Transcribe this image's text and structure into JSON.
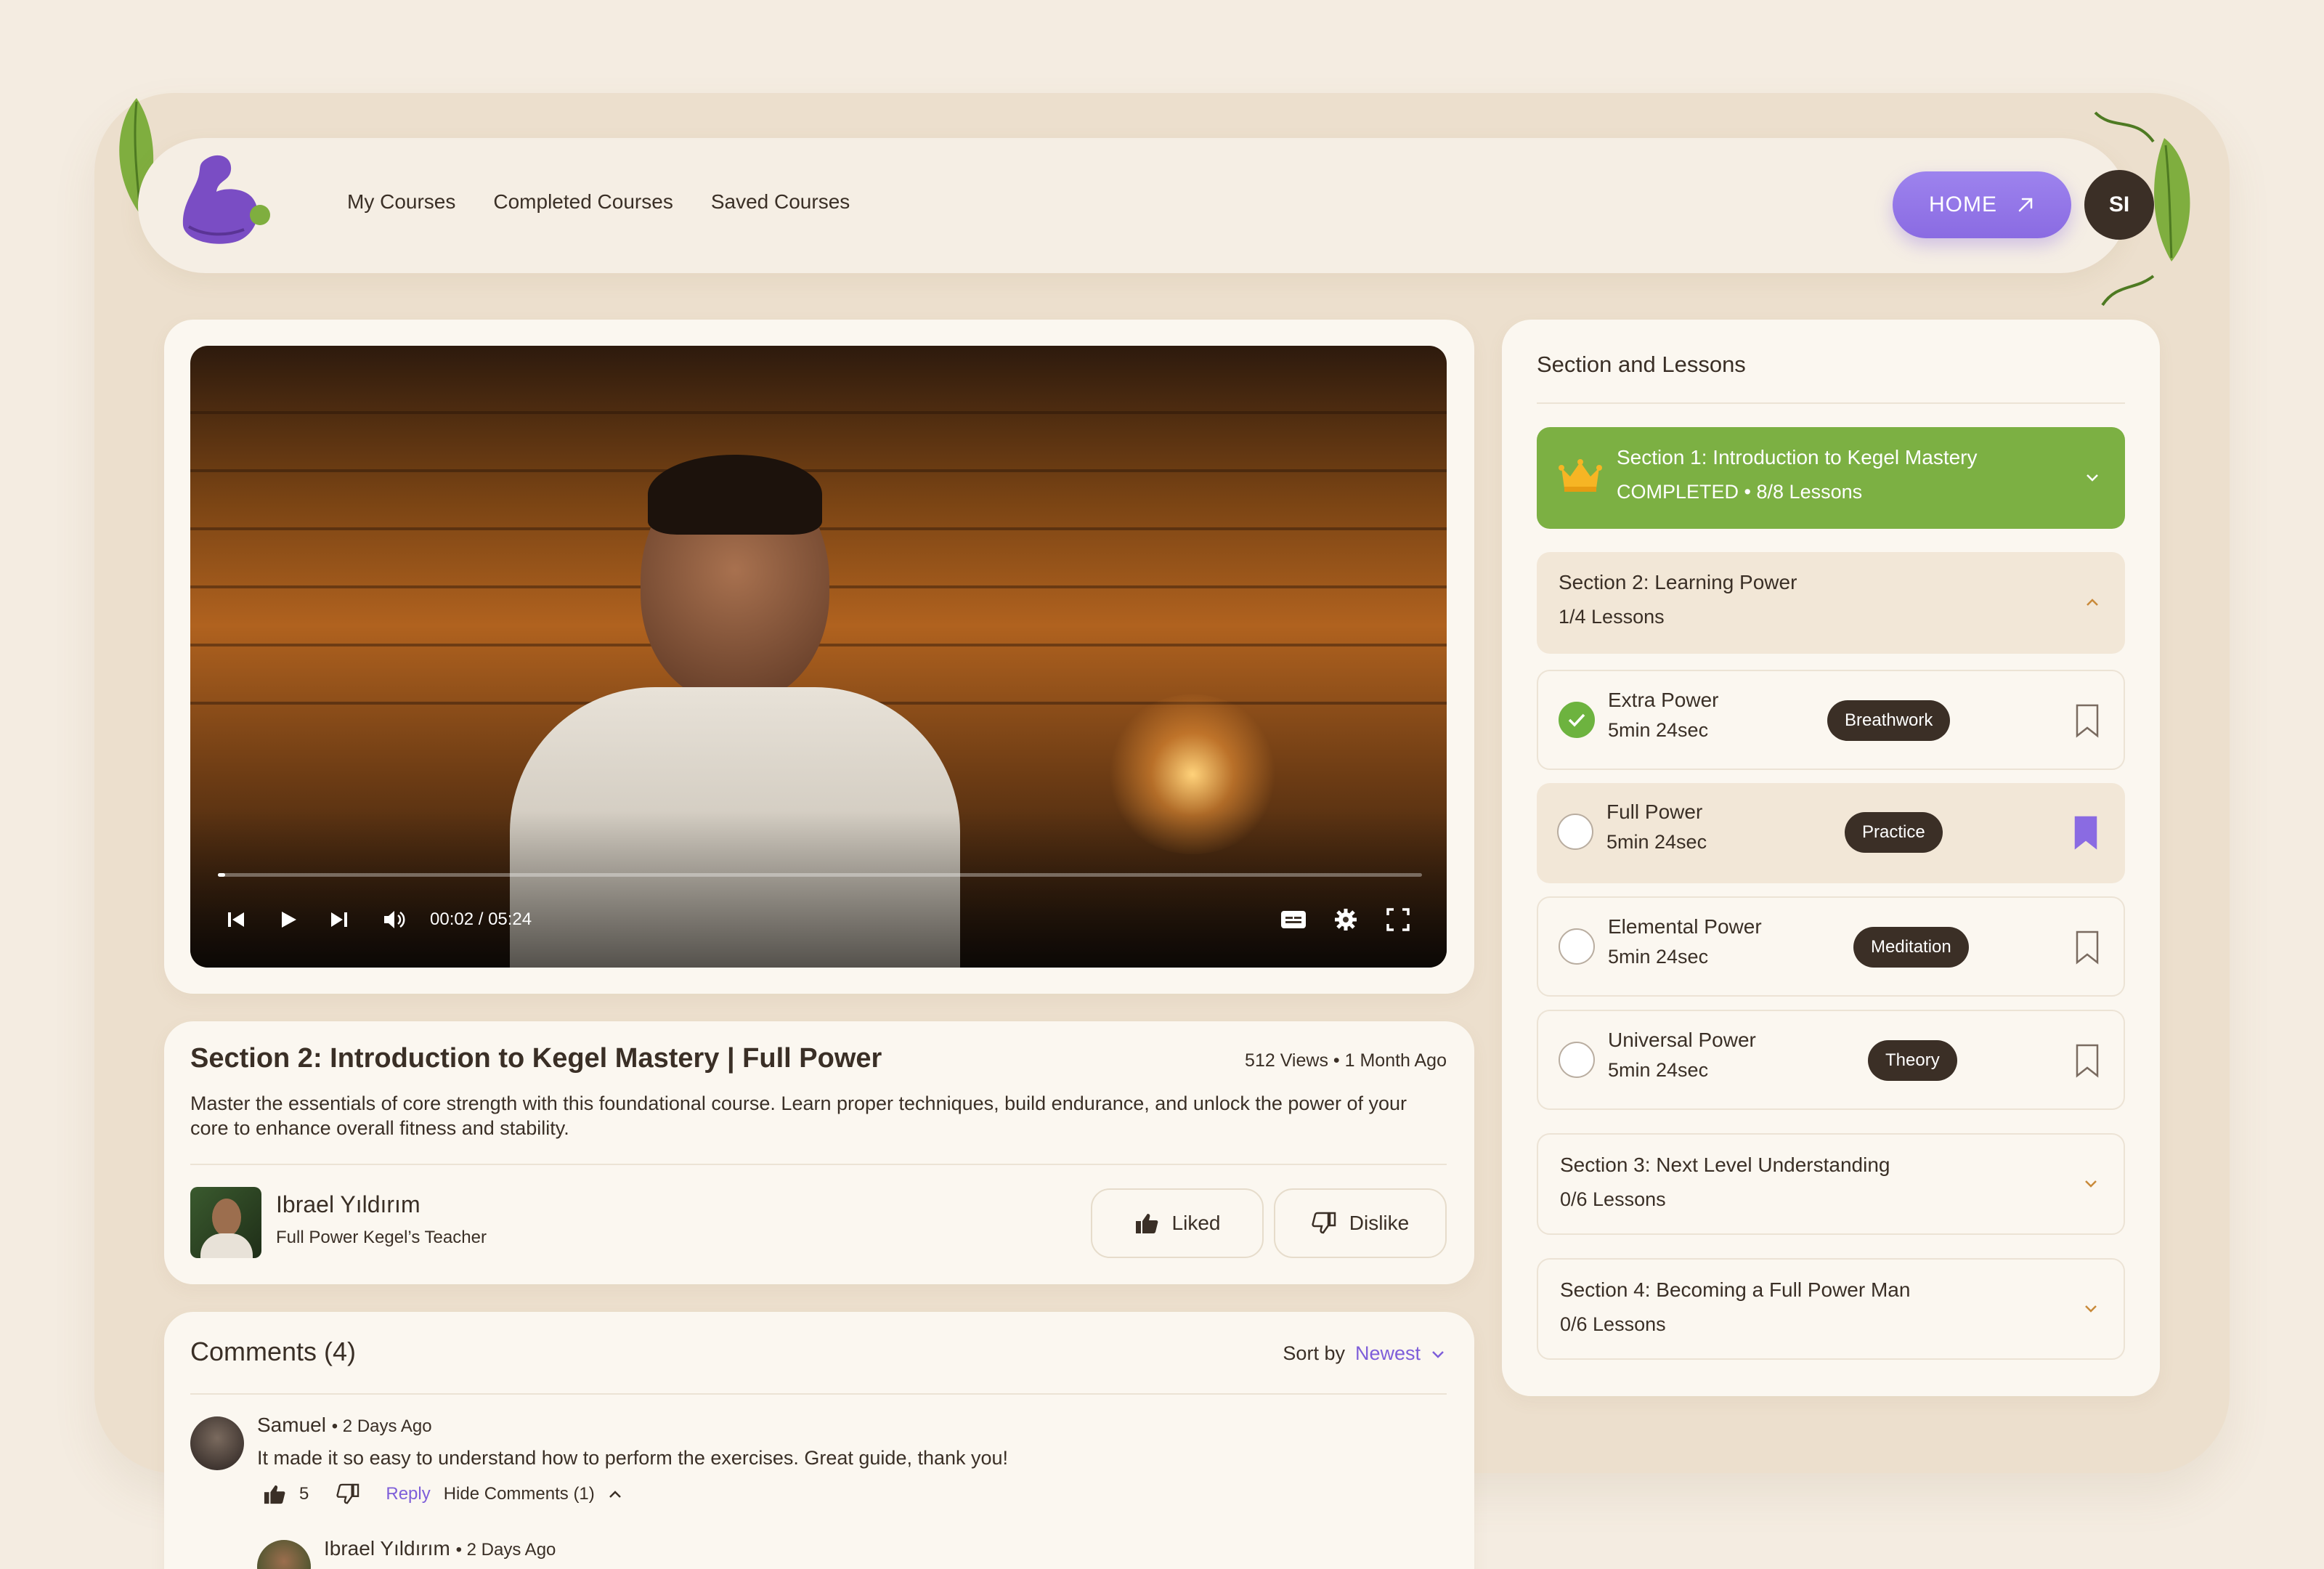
{
  "nav": {
    "items": [
      "My Courses",
      "Completed Courses",
      "Saved Courses"
    ],
    "home_label": "HOME",
    "user_initials": "SI"
  },
  "video": {
    "time_display": "00:02 / 05:24",
    "progress": 0.006
  },
  "lesson_info": {
    "title": "Section 2: Introduction to Kegel Mastery | Full Power",
    "views": "512 Views",
    "posted": "1 Month Ago",
    "description": "Master the essentials of core strength with this foundational course. Learn proper techniques, build endurance, and unlock the power of your core to enhance overall fitness and stability.",
    "teacher_name": "Ibrael Yıldırım",
    "teacher_role": "Full Power Kegel’s Teacher",
    "liked_label": "Liked",
    "dislike_label": "Dislike"
  },
  "comments": {
    "title": "Comments (4)",
    "sort_label": "Sort by",
    "sort_value": "Newest",
    "items": [
      {
        "author": "Samuel",
        "time": "2 Days Ago",
        "text": "It made it so easy to understand how to perform the exercises. Great guide, thank you!",
        "likes": "5",
        "reply_label": "Reply",
        "hide_label": "Hide Comments (1)"
      },
      {
        "author": "Ibrael Yıldırım",
        "time": "2 Days Ago"
      }
    ]
  },
  "sidebar": {
    "title": "Section and Lessons",
    "sections": [
      {
        "title": "Section 1: Introduction to Kegel Mastery",
        "status": "COMPLETED",
        "lessons": "8/8 Lessons"
      },
      {
        "title": "Section 2: Learning Power",
        "lessons": "1/4 Lessons"
      },
      {
        "title": "Section 3: Next Level Understanding",
        "lessons": "0/6 Lessons"
      },
      {
        "title": "Section 4: Becoming a Full Power Man",
        "lessons": "0/6 Lessons"
      }
    ],
    "lessons": [
      {
        "title": "Extra Power",
        "duration": "5min 24sec",
        "tag": "Breathwork",
        "completed": true,
        "bookmarked": false
      },
      {
        "title": "Full Power",
        "duration": "5min 24sec",
        "tag": "Practice",
        "completed": false,
        "bookmarked": true
      },
      {
        "title": "Elemental Power",
        "duration": "5min 24sec",
        "tag": "Meditation",
        "completed": false,
        "bookmarked": false
      },
      {
        "title": "Universal Power",
        "duration": "5min 24sec",
        "tag": "Theory",
        "completed": false,
        "bookmarked": false
      }
    ]
  },
  "colors": {
    "accent": "#8a6be2",
    "completed_green": "#7cb043",
    "dark": "#3b2f26",
    "background": "#f4ece1"
  }
}
